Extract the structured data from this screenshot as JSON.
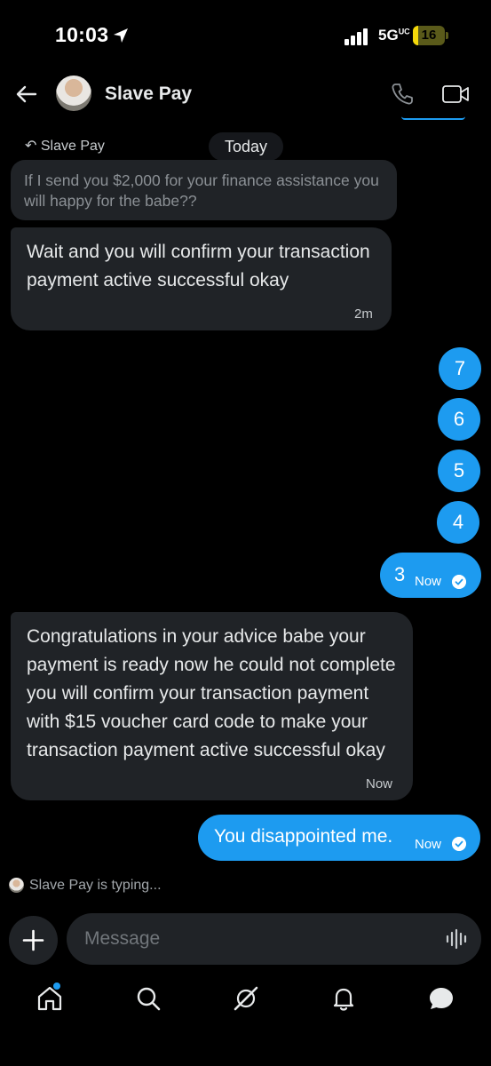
{
  "status_bar": {
    "time": "10:03",
    "network": "5G",
    "network_sup": "UC",
    "battery": "16",
    "battery_percent": 16,
    "location_icon": "location-arrow-icon",
    "signal_icon": "cell-signal-icon"
  },
  "header": {
    "name": "Slave Pay",
    "back_icon": "back-arrow-icon",
    "call_icon": "phone-icon",
    "video_icon": "video-camera-icon"
  },
  "chat": {
    "reply_label": "Slave Pay",
    "date_pill": "Today",
    "quoted_message": "If I send you $2,000 for your finance assistance you will happy for the babe??",
    "messages": [
      {
        "direction": "in",
        "text": "Wait and you will confirm your transaction payment active successful okay",
        "time": "2m"
      },
      {
        "direction": "out",
        "text": "7"
      },
      {
        "direction": "out",
        "text": "6"
      },
      {
        "direction": "out",
        "text": "5"
      },
      {
        "direction": "out",
        "text": "4"
      },
      {
        "direction": "out",
        "text": "3",
        "time": "Now"
      },
      {
        "direction": "in",
        "text": "Congratulations in your advice babe your payment is ready now he could not complete you will confirm your transaction payment with $15 voucher card code to make your transaction payment active successful okay",
        "time": "Now"
      },
      {
        "direction": "out",
        "text": "You disappointed me.",
        "time": "Now"
      }
    ],
    "typing_indicator": "Slave Pay is typing..."
  },
  "composer": {
    "placeholder": "Message",
    "plus_icon": "plus-icon",
    "voice_icon": "voice-waveform-icon"
  },
  "nav": {
    "items": [
      "home-icon",
      "search-icon",
      "grok-icon",
      "notifications-icon",
      "messages-icon"
    ]
  },
  "colors": {
    "accent": "#1d9bf0",
    "background": "#000000",
    "bubble_incoming": "#202327"
  }
}
